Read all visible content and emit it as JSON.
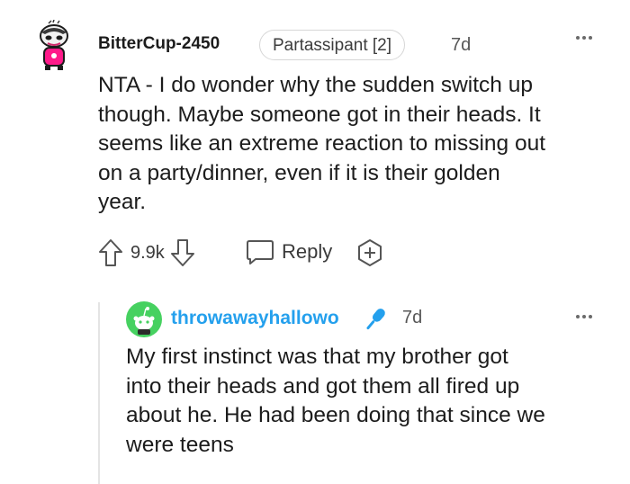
{
  "comment": {
    "username": "BitterCup-2450",
    "flair": "Partassipant [2]",
    "age": "7d",
    "body": "NTA - I do wonder why the sudden switch up\nthough. Maybe someone got in their heads. It\nseems like an extreme reaction to missing out\non a party/dinner, even if it is their golden\nyear.",
    "score": "9.9k",
    "reply_label": "Reply",
    "icons": {
      "more": "more-dots-icon",
      "upvote": "arrow-up-icon",
      "downvote": "arrow-down-icon",
      "reply": "chat-bubble-icon",
      "award": "plus-circle-icon"
    }
  },
  "reply": {
    "username": "throwawayhallowo",
    "age": "7d",
    "body": "My first instinct was that my brother got\ninto their heads and got them all fired up\nabout he. He had been doing that since we\nwere teens",
    "icons": {
      "op_badge": "microphone-icon",
      "more": "more-dots-icon"
    }
  },
  "colors": {
    "op_username": "#24a0ed",
    "avatar2_bg": "#46d160",
    "text": "#1c1c1c",
    "meta": "#575757"
  }
}
